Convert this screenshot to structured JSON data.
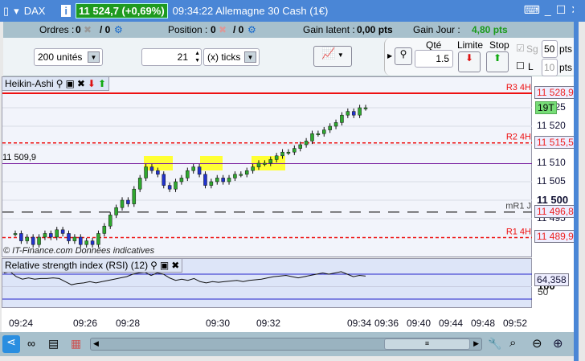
{
  "title": {
    "symbol": "DAX",
    "price": "11 524,7 (+0,69%)",
    "time_name": "09:34:22 Allemagne 30 Cash (1€)"
  },
  "info": {
    "orders_label": "Ordres :",
    "orders_val": "0",
    "orders_val2": "/ 0",
    "position_label": "Position :",
    "position_val": "0",
    "position_val2": "/ 0",
    "gain_latent_label": "Gain latent :",
    "gain_latent": "0,00 pts",
    "gain_jour_label": "Gain Jour :",
    "gain_jour": "4,80 pts"
  },
  "toolbar": {
    "units": "200 unités",
    "ticks_value": "21",
    "ticks_unit": "(x) ticks",
    "qty_label": "Qté",
    "qty": "1.5",
    "limit_label": "Limite",
    "stop_label": "Stop",
    "sg_label": "Sg",
    "sg_pts": "50",
    "l_label": "L",
    "l_pts": "10",
    "pts": "pts"
  },
  "chart": {
    "name": "Heikin-Ashi",
    "watermark": "© IT-Finance.com   Données indicatives",
    "left_label": "11 509,9",
    "badge": "19T",
    "levels": [
      {
        "name": "R3 4H",
        "value": "11 528,9",
        "price": 11528.9,
        "style": "solid",
        "color": "#ee1111"
      },
      {
        "name": "R2 4H",
        "value": "11 515,5",
        "price": 11515.5,
        "style": "dashed",
        "color": "#ee1111"
      },
      {
        "name": "mR1 J",
        "value": "11 496,8",
        "price": 11496.8,
        "style": "longdash",
        "color": "#444444"
      },
      {
        "name": "R1 4H",
        "value": "11 489,9",
        "price": 11489.9,
        "style": "dashed",
        "color": "#ee1111"
      }
    ],
    "ticks": [
      "11 525",
      "11 520",
      "11 510",
      "11 505",
      "11 500",
      "11 495"
    ],
    "closes": [
      11491,
      11489,
      11490,
      11488,
      11490,
      11491,
      11490,
      11492,
      11491,
      11489,
      11490,
      11488,
      11489,
      11488,
      11491,
      11493,
      11496,
      11498,
      11500,
      11499,
      11503,
      11506,
      11509,
      11508,
      11507,
      11504,
      11503,
      11505,
      11506,
      11508,
      11509,
      11507,
      11504,
      11505,
      11506,
      11505,
      11506,
      11507,
      11507,
      11508,
      11509,
      11510,
      11510,
      11511,
      11512,
      11513,
      11513,
      11514,
      11515,
      11516,
      11518,
      11518,
      11519,
      11520,
      11521,
      11523,
      11524,
      11523,
      11525,
      11525
    ]
  },
  "rsi": {
    "name": "Relative strength index (RSI) (12)",
    "top": "100",
    "value": "64,358",
    "mid": "50",
    "series": [
      72,
      74,
      66,
      62,
      64,
      62,
      63,
      63,
      64,
      63,
      58,
      53,
      55,
      56,
      58,
      56,
      58,
      60,
      62,
      64,
      66,
      70,
      72,
      73,
      68,
      72,
      70,
      64,
      60,
      62,
      60,
      63,
      58,
      56,
      58,
      57,
      58,
      59,
      60,
      58,
      60,
      61,
      62,
      64,
      66,
      67,
      68,
      66,
      64,
      66,
      68,
      70,
      72,
      70,
      72,
      74,
      70,
      66,
      68,
      67
    ]
  },
  "xaxis": [
    "09:24",
    "09:26",
    "09:28",
    "09:30",
    "09:32",
    "09:34",
    "09:36",
    "09:40",
    "09:44",
    "09:48",
    "09:52"
  ]
}
